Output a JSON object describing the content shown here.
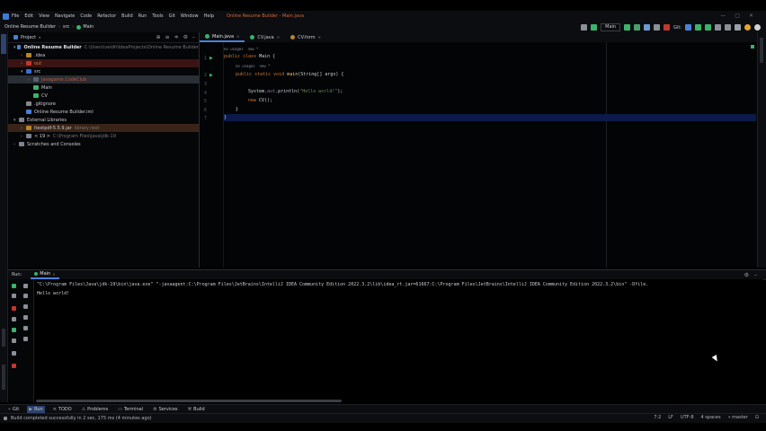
{
  "menubar": {
    "items": [
      "File",
      "Edit",
      "View",
      "Navigate",
      "Code",
      "Refactor",
      "Build",
      "Run",
      "Tools",
      "Git",
      "Window",
      "Help"
    ],
    "title": "Online Resume Builder - Main.java"
  },
  "toolbar": {
    "crumbs": [
      "Online Resume Builder",
      "src",
      "Main"
    ],
    "config": "Main",
    "git_label": "Git:"
  },
  "project": {
    "label": "Project",
    "tree": [
      {
        "indent": 0,
        "arrow": "▾",
        "icon": "#4a7fd6",
        "label": "Online Resume Builder",
        "extra": "C:\\Users\\veidh\\IdeaProjects\\Online Resume Builder",
        "color": "#e0e3e8",
        "bold": true
      },
      {
        "indent": 1,
        "arrow": "›",
        "icon": "#b5862d",
        "label": ".idea",
        "extra": "",
        "color": "#c9ccd2"
      },
      {
        "indent": 1,
        "arrow": "›",
        "icon": "#c0392b",
        "label": "out",
        "extra": "",
        "color": "#c97a3a",
        "bg": "#3a1414"
      },
      {
        "indent": 1,
        "arrow": "▾",
        "icon": "#3b6fd0",
        "label": "src",
        "extra": "",
        "color": "#c9ccd2"
      },
      {
        "indent": 2,
        "arrow": "›",
        "icon": "#5a5f68",
        "label": "Javagame.CodeClub",
        "extra": "",
        "color": "#c05a3a",
        "bg": "#2a2e35"
      },
      {
        "indent": 2,
        "arrow": "",
        "icon": "#3bb36a",
        "label": "Main",
        "extra": "",
        "color": "#c9ccd2"
      },
      {
        "indent": 2,
        "arrow": "",
        "icon": "#3bb36a",
        "label": "CV",
        "extra": "",
        "color": "#c9ccd2"
      },
      {
        "indent": 1,
        "arrow": "",
        "icon": "#888",
        "label": ".gitignore",
        "extra": "",
        "color": "#c9ccd2"
      },
      {
        "indent": 1,
        "arrow": "",
        "icon": "#4a7fd6",
        "label": "Online Resume Builder.iml",
        "extra": "",
        "color": "#c9ccd2"
      },
      {
        "indent": 0,
        "arrow": "▾",
        "icon": "#7d8490",
        "label": "External Libraries",
        "extra": "",
        "color": "#c9ccd2"
      },
      {
        "indent": 1,
        "arrow": "›",
        "icon": "#b5862d",
        "label": "itextpdf-5.5.9.jar",
        "extra": "library root",
        "color": "#c9ccd2",
        "bg": "#3a2418"
      },
      {
        "indent": 1,
        "arrow": "›",
        "icon": "#7d8490",
        "label": "< 19 >",
        "extra": "C:\\Program Files\\Java\\jdk-19",
        "color": "#c9ccd2"
      },
      {
        "indent": 0,
        "arrow": "›",
        "icon": "#7d8490",
        "label": "Scratches and Consoles",
        "extra": "",
        "color": "#c9ccd2"
      }
    ]
  },
  "editor": {
    "tabs": [
      {
        "label": "Main.java",
        "color": "#3bb36a",
        "active": true
      },
      {
        "label": "CV.java",
        "color": "#3bb36a",
        "active": false
      },
      {
        "label": "CV.form",
        "color": "#b5862d",
        "active": false
      }
    ],
    "hint_top": "no usages  new *",
    "hint_method": "no usages  new *",
    "lines": {
      "l1_kw": "public class ",
      "l1_name": "Main {",
      "l2_kw": "public static void ",
      "l2_fn": "main",
      "l2_rest": "(String[] args) {",
      "l4_a": "System.",
      "l4_b": "out",
      "l4_c": ".println(",
      "l4_str": "\"Hello world!\"",
      "l4_d": ");",
      "l5_kw": "new ",
      "l5_rest": "CV();",
      "l6": "}",
      "l7": "}"
    },
    "line_numbers": [
      "1",
      "2",
      "3",
      "4",
      "5",
      "6",
      "7"
    ]
  },
  "run": {
    "label": "Run:",
    "tab": "Main",
    "cmd": "\"C:\\Program Files\\Java\\jdk-19\\bin\\java.exe\" \"-javaagent:C:\\Program Files\\JetBrains\\IntelliJ IDEA Community Edition 2022.3.2\\lib\\idea_rt.jar=61667:C:\\Program Files\\JetBrains\\IntelliJ IDEA Community Edition 2022.3.2\\bin\" -Dfile.",
    "output": "Hello world!"
  },
  "bottomtabs": [
    "Git",
    "Run",
    "TODO",
    "Problems",
    "Terminal",
    "Services",
    "Build"
  ],
  "status": {
    "message": "Build completed successfully in 2 sec, 175 ms (4 minutes ago)",
    "pos": "7:2",
    "eol": "LF",
    "enc": "UTF-8",
    "indent": "4 spaces",
    "branch": "master"
  }
}
